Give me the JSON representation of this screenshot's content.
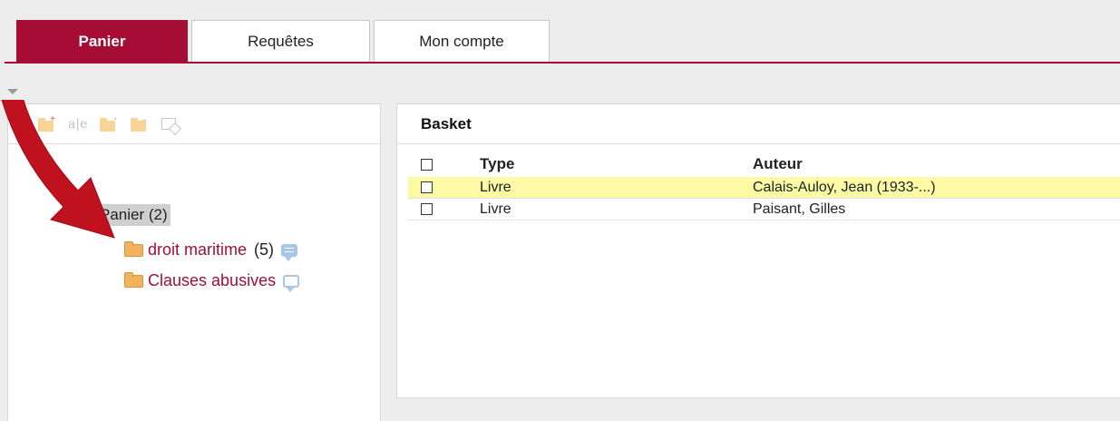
{
  "tabs": [
    {
      "label": "Panier",
      "active": true
    },
    {
      "label": "Requêtes",
      "active": false
    },
    {
      "label": "Mon compte",
      "active": false
    }
  ],
  "colors": {
    "accent": "#a50d35",
    "link": "#a00f35",
    "highlight": "#fdfaa6",
    "arrow": "#c0111f"
  },
  "toolbar": {
    "icons": [
      "new-folder-icon",
      "rename-icon",
      "copy-folder-icon",
      "move-folder-icon",
      "export-icon"
    ],
    "rename_text": "a|e"
  },
  "tree": {
    "root": {
      "label": "Panier (2)"
    },
    "children": [
      {
        "label": "droit maritime",
        "count": "(5)",
        "comment": "filled"
      },
      {
        "label": "Clauses abusives",
        "count": "",
        "comment": "empty"
      }
    ]
  },
  "basket": {
    "title": "Basket",
    "columns": [
      "Type",
      "Auteur"
    ],
    "rows": [
      {
        "type": "Livre",
        "author": "Calais-Auloy, Jean (1933-...)",
        "highlighted": true
      },
      {
        "type": "Livre",
        "author": "Paisant, Gilles",
        "highlighted": false
      }
    ]
  }
}
